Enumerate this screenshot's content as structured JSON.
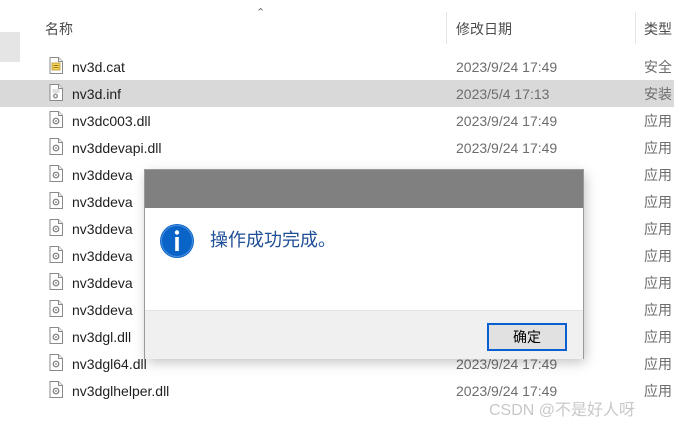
{
  "columns": {
    "name": "名称",
    "date": "修改日期",
    "type": "类型"
  },
  "files": [
    {
      "name": "nv3d.cat",
      "date": "2023/9/24 17:49",
      "type": "安全",
      "icon": "catalog-file-icon"
    },
    {
      "name": "nv3d.inf",
      "date": "2023/5/4 17:13",
      "type": "安装",
      "icon": "setup-info-file-icon",
      "selected": true
    },
    {
      "name": "nv3dc003.dll",
      "date": "2023/9/24 17:49",
      "type": "应用",
      "icon": "dll-file-icon"
    },
    {
      "name": "nv3ddevapi.dll",
      "date": "2023/9/24 17:49",
      "type": "应用",
      "icon": "dll-file-icon"
    },
    {
      "name": "nv3ddeva",
      "date": "",
      "type": "应用",
      "icon": "dll-file-icon"
    },
    {
      "name": "nv3ddeva",
      "date": "",
      "type": "应用",
      "icon": "dll-file-icon"
    },
    {
      "name": "nv3ddeva",
      "date": "",
      "type": "应用",
      "icon": "dll-file-icon"
    },
    {
      "name": "nv3ddeva",
      "date": "",
      "type": "应用",
      "icon": "dll-file-icon"
    },
    {
      "name": "nv3ddeva",
      "date": "",
      "type": "应用",
      "icon": "dll-file-icon"
    },
    {
      "name": "nv3ddeva",
      "date": "",
      "type": "应用",
      "icon": "dll-file-icon"
    },
    {
      "name": "nv3dgl.dll",
      "date": "",
      "type": "应用",
      "icon": "dll-file-icon"
    },
    {
      "name": "nv3dgl64.dll",
      "date": "2023/9/24 17:49",
      "type": "应用",
      "icon": "dll-file-icon"
    },
    {
      "name": "nv3dglhelper.dll",
      "date": "2023/9/24 17:49",
      "type": "应用",
      "icon": "dll-file-icon"
    }
  ],
  "dialog": {
    "message": "操作成功完成。",
    "ok_label": "确定",
    "icon": "info-icon",
    "accent": "#0a64c8"
  },
  "watermark": "CSDN @不是好人呀"
}
